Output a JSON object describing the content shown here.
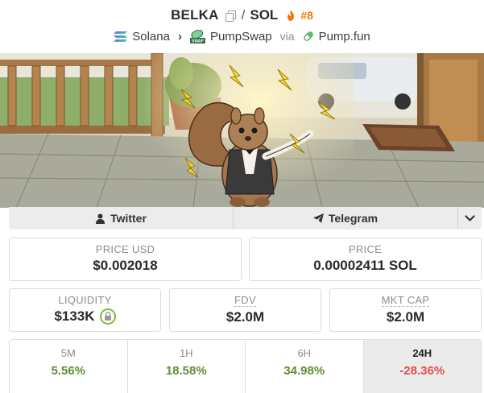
{
  "header": {
    "base_token": "BELKA",
    "separator": "/",
    "quote_token": "SOL",
    "rank": "#8",
    "chain": "Solana",
    "dex": "PumpSwap",
    "via": "via",
    "launchpad": "Pump.fun",
    "icons": [
      "copy-icon",
      "fire-icon",
      "solana-icon",
      "chevron-right-icon",
      "pumpswap-icon",
      "pill-icon"
    ]
  },
  "banner": {
    "description_icon": "squirrel-banner"
  },
  "social": {
    "twitter_label": "Twitter",
    "telegram_label": "Telegram",
    "icons": [
      "user-icon",
      "send-icon",
      "chevron-down-icon"
    ]
  },
  "stats": {
    "price_usd_label": "PRICE USD",
    "price_usd_value": "$0.002018",
    "price_label": "PRICE",
    "price_value": "0.00002411 SOL",
    "liquidity_label": "LIQUIDITY",
    "liquidity_value": "$133K",
    "fdv_label": "FDV",
    "fdv_value": "$2.0M",
    "mktcap_label": "MKT CAP",
    "mktcap_value": "$2.0M"
  },
  "timeframes": [
    {
      "label": "5M",
      "value": "5.56%"
    },
    {
      "label": "1H",
      "value": "18.58%"
    },
    {
      "label": "6H",
      "value": "34.98%"
    },
    {
      "label": "24H",
      "value": "-28.36%"
    }
  ],
  "colors": {
    "positive": "#5e8f2f",
    "negative": "#e24d4d",
    "rank": "#ee7a0c",
    "lock": "#7bbf3a"
  }
}
